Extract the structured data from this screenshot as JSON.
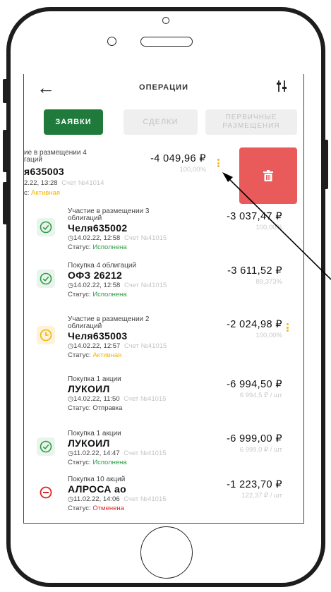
{
  "header": {
    "title": "ОПЕРАЦИИ",
    "back_icon": "arrow-left-icon",
    "filter_icon": "sliders-icon"
  },
  "tabs": [
    {
      "label": "ЗАЯВКИ",
      "active": true
    },
    {
      "label": "СДЕЛКИ",
      "active": false
    },
    {
      "label_line1": "ПЕРВИЧНЫЕ",
      "label_line2": "РАЗМЕЩЕНИЯ",
      "active": false
    }
  ],
  "swiped_order": {
    "operation_line1": "ие в размещении 4",
    "operation_line2": "гаций",
    "security": "я635003",
    "datetime": "2.22, 13:28",
    "account": "Счет №41014",
    "status_label": "с:",
    "status": "Активная",
    "amount": "-4 049,96 ₽",
    "sub": "100,00%",
    "delete_icon": "trash-icon",
    "delete_color": "#e95b5b"
  },
  "orders": [
    {
      "icon": "check-circle-icon",
      "icon_color": "#2e9b46",
      "operation_line1": "Участие в размещении 3",
      "operation_line2": "облигаций",
      "security": "Челя635002",
      "datetime": "◷14.02.22, 12:58",
      "account": "Счет №41015",
      "status_label": "Статус:",
      "status": "Исполнена",
      "status_type": "green",
      "amount": "-3 037,47 ₽",
      "sub": "100,00%",
      "menu": false
    },
    {
      "icon": "check-circle-icon",
      "icon_color": "#2e9b46",
      "operation_line1": "Покупка 4 облигаций",
      "operation_line2": "",
      "security": "ОФЗ 26212",
      "datetime": "◷14.02.22, 12:58",
      "account": "Счет №41015",
      "status_label": "Статус:",
      "status": "Исполнена",
      "status_type": "green",
      "amount": "-3 611,52 ₽",
      "sub": "89,373%",
      "menu": false
    },
    {
      "icon": "clock-icon",
      "icon_color": "#f4b400",
      "operation_line1": "Участие в размещении 2",
      "operation_line2": "облигаций",
      "security": "Челя635003",
      "datetime": "◷14.02.22, 12:57",
      "account": "Счет №41015",
      "status_label": "Статус:",
      "status": "Активная",
      "status_type": "yellow",
      "amount": "-2 024,98 ₽",
      "sub": "100,00%",
      "menu": true
    },
    {
      "icon": "none",
      "operation_line1": "Покупка 1 акции",
      "operation_line2": "",
      "security": "ЛУКОИЛ",
      "datetime": "◷14.02.22, 11:50",
      "account": "Счет №41015",
      "status_label": "Статус:",
      "status": "Отправка",
      "status_type": "plain",
      "amount": "-6 994,50 ₽",
      "sub": "6 994,5 ₽ / шт",
      "menu": false
    },
    {
      "icon": "check-circle-icon",
      "icon_color": "#2e9b46",
      "operation_line1": "Покупка 1 акции",
      "operation_line2": "",
      "security": "ЛУКОИЛ",
      "datetime": "◷11.02.22, 14:47",
      "account": "Счет №41015",
      "status_label": "Статус:",
      "status": "Исполнена",
      "status_type": "green",
      "amount": "-6 999,00 ₽",
      "sub": "6 999,0 ₽ / шт",
      "menu": false
    },
    {
      "icon": "minus-circle-icon",
      "icon_color": "#d92828",
      "operation_line1": "Покупка 10 акций",
      "operation_line2": "",
      "security": "АЛРОСА ао",
      "datetime": "◷11.02.22, 14:06",
      "account": "Счет №41015",
      "status_label": "Статус:",
      "status": "Отменена",
      "status_type": "red",
      "amount": "-1 223,70 ₽",
      "sub": "122,37 ₽ / шт",
      "menu": false
    }
  ],
  "colors": {
    "brand_green": "#1f7a3c",
    "active_yellow": "#f4b400",
    "cancel_red": "#d92828"
  }
}
